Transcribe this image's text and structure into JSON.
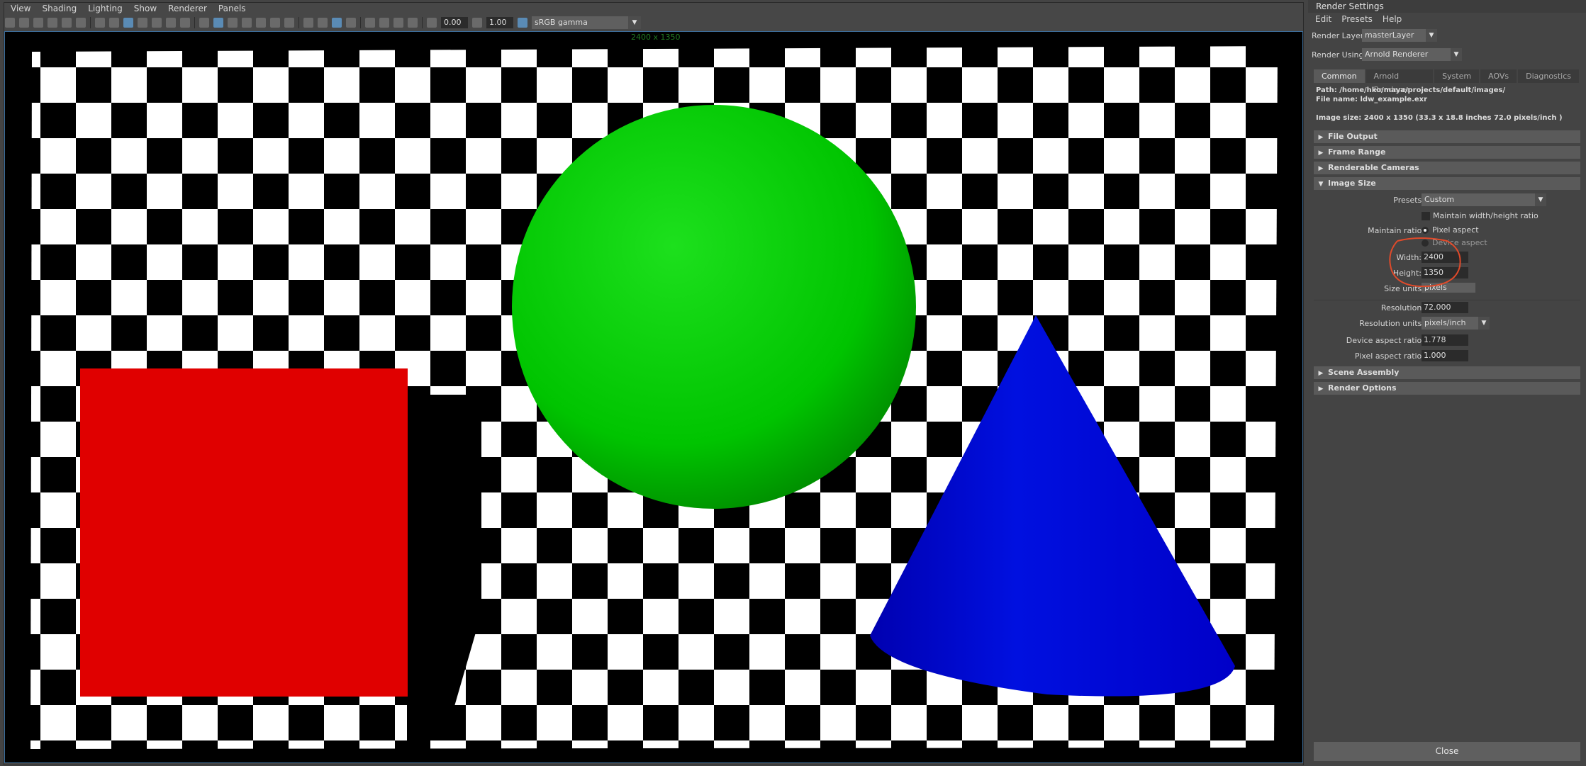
{
  "viewport": {
    "menu": [
      "View",
      "Shading",
      "Lighting",
      "Show",
      "Renderer",
      "Panels"
    ],
    "exposure": "0.00",
    "gamma": "1.00",
    "color_space": "sRGB gamma",
    "resolution_label": "2400 x 1350",
    "scene": {
      "background": "#000000",
      "checker_colors": [
        "#000000",
        "#ffffff"
      ],
      "objects": [
        {
          "name": "red cube",
          "color": "#e00000"
        },
        {
          "name": "green sphere",
          "color": "#00cc00"
        },
        {
          "name": "blue cone",
          "color": "#0000d0"
        }
      ]
    }
  },
  "render_settings": {
    "title": "Render Settings",
    "menu": [
      "Edit",
      "Presets",
      "Help"
    ],
    "render_layer_label": "Render Layer",
    "render_layer_value": "masterLayer",
    "render_using_label": "Render Using",
    "render_using_value": "Arnold Renderer",
    "tabs": [
      "Common",
      "Arnold Renderer",
      "System",
      "AOVs",
      "Diagnostics"
    ],
    "path": "Path: /home/hko/maya/projects/default/images/",
    "file_name": "File name:  ldw_example.exr",
    "image_size_info": "Image size: 2400 x 1350 (33.3 x 18.8 inches 72.0 pixels/inch )",
    "sections_top": [
      "File Output",
      "Frame Range",
      "Renderable Cameras"
    ],
    "image_size_section": "Image Size",
    "presets_label": "Presets:",
    "presets_value": "Custom",
    "maintain_wh_label": "Maintain width/height ratio",
    "maintain_ratio_label": "Maintain ratio:",
    "pixel_aspect_label": "Pixel aspect",
    "device_aspect_label": "Device aspect",
    "width_label": "Width:",
    "width_value": "2400",
    "height_label": "Height:",
    "height_value": "1350",
    "size_units_label": "Size units:",
    "size_units_value": "pixels",
    "resolution_label": "Resolution:",
    "resolution_value": "72.000",
    "resolution_units_label": "Resolution units:",
    "resolution_units_value": "pixels/inch",
    "device_aspect_ratio_label": "Device aspect ratio:",
    "device_aspect_ratio_value": "1.778",
    "pixel_aspect_ratio_label": "Pixel aspect ratio:",
    "pixel_aspect_ratio_value": "1.000",
    "sections_bottom": [
      "Scene Assembly",
      "Render Options"
    ],
    "close_label": "Close",
    "annotation_color": "#e04a2a"
  }
}
